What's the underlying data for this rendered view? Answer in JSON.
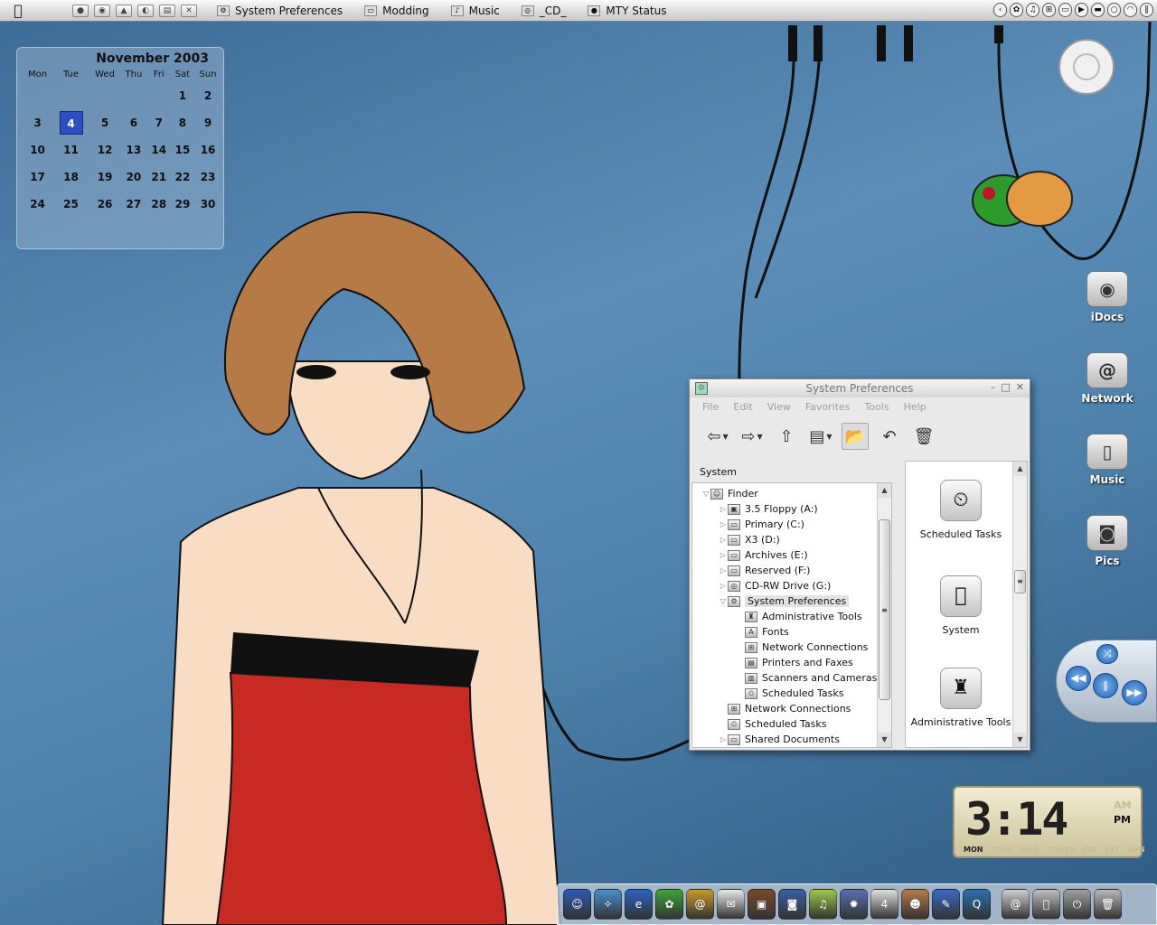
{
  "menubar": {
    "apple_icon": "apple-logo-icon",
    "quick_launch": [
      "app-icon-1",
      "app-icon-2",
      "app-icon-3",
      "app-icon-4",
      "app-icon-5",
      "app-icon-6"
    ],
    "tasks": [
      {
        "label": "System Preferences",
        "icon": "system-preferences-icon"
      },
      {
        "label": "Modding",
        "icon": "folder-icon"
      },
      {
        "label": "Music",
        "icon": "music-icon"
      },
      {
        "label": "_CD_",
        "icon": "cd-icon"
      },
      {
        "label": "MTY Status",
        "icon": "status-icon"
      }
    ],
    "tray": [
      "chevron-left-icon",
      "paw-icon",
      "speaker-icon",
      "network-icon",
      "monitor-icon",
      "play-icon",
      "battery-icon",
      "chat-icon",
      "wifi-icon",
      "pause-icon"
    ]
  },
  "calendar": {
    "title": "November 2003",
    "weekdays": [
      "Mon",
      "Tue",
      "Wed",
      "Thu",
      "Fri",
      "Sat",
      "Sun"
    ],
    "weeks": [
      [
        "",
        "",
        "",
        "",
        "",
        "1",
        "2"
      ],
      [
        "3",
        "4",
        "5",
        "6",
        "7",
        "8",
        "9"
      ],
      [
        "10",
        "11",
        "12",
        "13",
        "14",
        "15",
        "16"
      ],
      [
        "17",
        "18",
        "19",
        "20",
        "21",
        "22",
        "23"
      ],
      [
        "24",
        "25",
        "26",
        "27",
        "28",
        "29",
        "30"
      ]
    ],
    "today": "4"
  },
  "desktop_icons": [
    {
      "label": "iDocs",
      "icon": "docs-drive-icon"
    },
    {
      "label": "Network",
      "icon": "network-icon"
    },
    {
      "label": "Music",
      "icon": "ipod-icon"
    },
    {
      "label": "Pics",
      "icon": "camera-icon"
    }
  ],
  "window": {
    "title": "System Preferences",
    "menu": [
      "File",
      "Edit",
      "View",
      "Favorites",
      "Tools",
      "Help"
    ],
    "pane_label": "System",
    "tree": [
      {
        "label": "Finder",
        "depth": 0,
        "expander": "▽",
        "icon": "finder-icon"
      },
      {
        "label": "3.5 Floppy (A:)",
        "depth": 1,
        "expander": "▷",
        "icon": "floppy-icon"
      },
      {
        "label": "Primary (C:)",
        "depth": 1,
        "expander": "▷",
        "icon": "drive-icon"
      },
      {
        "label": "X3 (D:)",
        "depth": 1,
        "expander": "▷",
        "icon": "drive-icon"
      },
      {
        "label": "Archives (E:)",
        "depth": 1,
        "expander": "▷",
        "icon": "drive-icon"
      },
      {
        "label": "Reserved (F:)",
        "depth": 1,
        "expander": "▷",
        "icon": "drive-icon"
      },
      {
        "label": "CD-RW Drive (G:)",
        "depth": 1,
        "expander": "▷",
        "icon": "cd-drive-icon"
      },
      {
        "label": "System Preferences",
        "depth": 1,
        "expander": "▽",
        "icon": "system-preferences-icon"
      },
      {
        "label": "Administrative Tools",
        "depth": 2,
        "expander": "",
        "icon": "admin-tools-icon"
      },
      {
        "label": "Fonts",
        "depth": 2,
        "expander": "",
        "icon": "fonts-icon"
      },
      {
        "label": "Network Connections",
        "depth": 2,
        "expander": "",
        "icon": "network-connections-icon"
      },
      {
        "label": "Printers and Faxes",
        "depth": 2,
        "expander": "",
        "icon": "printer-icon"
      },
      {
        "label": "Scanners and Cameras",
        "depth": 2,
        "expander": "",
        "icon": "scanner-icon"
      },
      {
        "label": "Scheduled Tasks",
        "depth": 2,
        "expander": "",
        "icon": "scheduled-tasks-icon"
      },
      {
        "label": "Network Connections",
        "depth": 1,
        "expander": "",
        "icon": "network-connections-icon"
      },
      {
        "label": "Scheduled Tasks",
        "depth": 1,
        "expander": "",
        "icon": "scheduled-tasks-icon"
      },
      {
        "label": "Shared Documents",
        "depth": 1,
        "expander": "▷",
        "icon": "folder-icon"
      }
    ],
    "selected_item": "System Preferences",
    "icons": [
      {
        "label": "Scheduled Tasks",
        "icon": "scheduled-tasks-icon"
      },
      {
        "label": "System",
        "icon": "system-apple-icon"
      },
      {
        "label": "Administrative Tools",
        "icon": "admin-tools-icon"
      }
    ]
  },
  "clock": {
    "time": "3:14",
    "am": "AM",
    "pm": "PM",
    "active_period": "PM",
    "days": [
      "MON",
      "TUES",
      "WED",
      "THURS",
      "FRI",
      "SAT",
      "SUN"
    ],
    "active_day": "MON"
  },
  "media": [
    "rewind-icon",
    "pause-icon",
    "fast-forward-icon",
    "shuffle-icon"
  ],
  "dock": [
    "finder-icon",
    "safari-icon",
    "internet-explorer-icon",
    "icq-icon",
    "address-book-icon",
    "mail-icon",
    "photos-icon",
    "camera-icon",
    "itunes-icon",
    "imovie-icon",
    "ical-icon",
    "iphoto-icon",
    "pen-icon",
    "quicktime-icon",
    "mail-at-icon",
    "apple-system-icon",
    "power-icon",
    "trash-icon"
  ],
  "colors": {
    "desktop": "#4f83ad",
    "calendar_today": "#2c4fc4",
    "dress": "#c62a22",
    "hair": "#b57a45"
  }
}
